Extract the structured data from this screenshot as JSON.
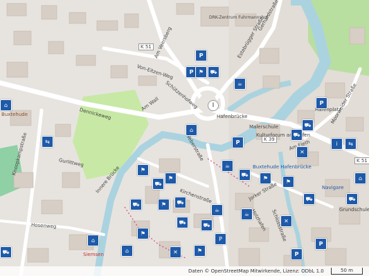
{
  "streets": {
    "schutzenhofweg": "Schützenhofweg",
    "von_eitzen_weg": "Von-Eitzen-Weg",
    "am_veersberg": "Am Veersberg",
    "dennickeweg": "Dennickeweg",
    "am_wall": "Am Wall",
    "gurlittweg": "Gurlittweg",
    "knoopkamp": "Knoopkampstraße",
    "innere_bruecke": "Innere Brücke",
    "kirchenstrasse": "Kirchenstraße",
    "weberstrasse": "Weberstraße",
    "hafenbruecke": "Hafenbrücke",
    "hafenplatz": "Hafenplatz",
    "moorweider": "Moorweider Straße",
    "estebruegger": "Estebrügger Straße",
    "gerhardstrasse": "Gerhardstraße",
    "hosenweg": "Hosenweg",
    "holzhafen": "Holzhafen",
    "jorkersstrasse": "Jorker Straße",
    "am_fleth": "Am Fleth",
    "schlossstrasse": "Schlossstraße"
  },
  "road_refs": {
    "k51_north": "K 51",
    "k39": "K 39",
    "k51_east": "K 51"
  },
  "places": {
    "drk": "DRK-Zentrum Fuhrmannshof",
    "buxtehude": "Buxtehude",
    "maierschule": "Malerschule",
    "kulturforum": "Kulturforum am Hafen",
    "buxtehude_hafen": "Buxtehude Hafenbrücke",
    "navigare": "Navigare",
    "grundschule": "Grundschule Harburger Straße",
    "siemsen": "Siemsen"
  },
  "attribution": "Daten © OpenStreetMap Mitwirkende, Lizenz: ODbL 1.0",
  "scale": "50 m",
  "colors": {
    "water": "#aad3df",
    "park": "#c8eba8",
    "building": "#d9d0c9",
    "poi": "#1f5aa8"
  },
  "pins": [
    "parking-icon",
    "food-icon",
    "shop-icon",
    "info-icon",
    "museum-icon",
    "hotel-icon",
    "bank-icon",
    "cafe-icon"
  ]
}
